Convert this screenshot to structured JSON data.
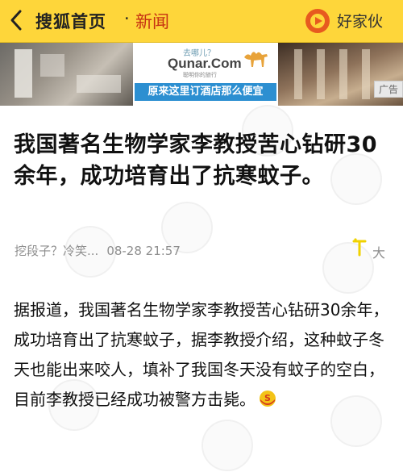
{
  "nav": {
    "back_icon": "chevron-left-icon",
    "home_label": "搜狐首页",
    "separator": "·",
    "section_label": "新闻",
    "brand_icon": "play-circle-icon",
    "brand_label": "好家伙"
  },
  "ad": {
    "slogan_top": "去哪儿？",
    "logo_text": "Qunar.Com",
    "tag_small": "聪明你的旅行",
    "tagline": "原来这里订酒店那么便宜",
    "badge": "广告",
    "colors": {
      "tagline_bg": "#2c8fd1",
      "camel": "#e8a33a"
    }
  },
  "article": {
    "title": "我国著名生物学家李教授苦心钻研30余年，成功培育出了抗寒蚊子。",
    "source": "挖段子？冷笑...",
    "datetime": "08-28 21:57",
    "font_size_icon": "text-size-icon",
    "font_size_label": "大",
    "body": "据报道，我国著名生物学家李教授苦心钻研30余年，成功培育出了抗寒蚊子，据李教授介绍，这种蚊子冬天也能出来咬人，填补了我国冬天没有蚊子的空白，目前李教授已经成功被警方击毙。",
    "emoji_icon": "sogou-emoji-icon"
  },
  "colors": {
    "topbar_bg": "#fed63a",
    "section_red": "#c63112",
    "brand_orange": "#e75a1f",
    "meta_gray": "#8e8e8e"
  }
}
